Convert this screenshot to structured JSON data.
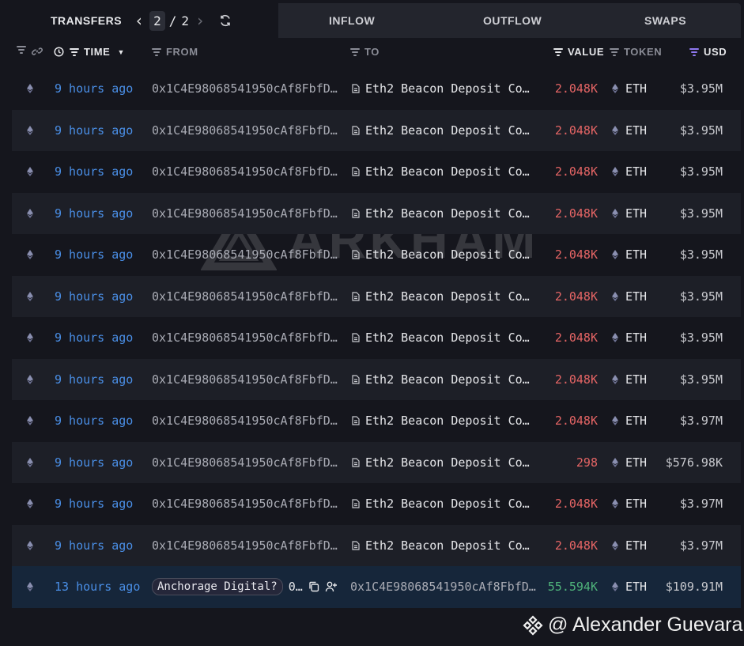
{
  "tabs": {
    "transfers": "TRANSFERS",
    "inflow": "INFLOW",
    "outflow": "OUTFLOW",
    "swaps": "SWAPS",
    "current_page": "2",
    "separator": "/",
    "total_pages": "2"
  },
  "columns": {
    "time": "TIME",
    "from": "FROM",
    "to": "TO",
    "value": "VALUE",
    "token": "TOKEN",
    "usd": "USD"
  },
  "rows": [
    {
      "time": "9 hours ago",
      "from": "0x1C4E98068541950cAf8FbfD…",
      "to": "Eth2 Beacon Deposit Co…",
      "value": "2.048K",
      "token": "ETH",
      "usd": "$3.95M"
    },
    {
      "time": "9 hours ago",
      "from": "0x1C4E98068541950cAf8FbfD…",
      "to": "Eth2 Beacon Deposit Co…",
      "value": "2.048K",
      "token": "ETH",
      "usd": "$3.95M"
    },
    {
      "time": "9 hours ago",
      "from": "0x1C4E98068541950cAf8FbfD…",
      "to": "Eth2 Beacon Deposit Co…",
      "value": "2.048K",
      "token": "ETH",
      "usd": "$3.95M"
    },
    {
      "time": "9 hours ago",
      "from": "0x1C4E98068541950cAf8FbfD…",
      "to": "Eth2 Beacon Deposit Co…",
      "value": "2.048K",
      "token": "ETH",
      "usd": "$3.95M"
    },
    {
      "time": "9 hours ago",
      "from": "0x1C4E98068541950cAf8FbfD…",
      "to": "Eth2 Beacon Deposit Co…",
      "value": "2.048K",
      "token": "ETH",
      "usd": "$3.95M"
    },
    {
      "time": "9 hours ago",
      "from": "0x1C4E98068541950cAf8FbfD…",
      "to": "Eth2 Beacon Deposit Co…",
      "value": "2.048K",
      "token": "ETH",
      "usd": "$3.95M"
    },
    {
      "time": "9 hours ago",
      "from": "0x1C4E98068541950cAf8FbfD…",
      "to": "Eth2 Beacon Deposit Co…",
      "value": "2.048K",
      "token": "ETH",
      "usd": "$3.95M"
    },
    {
      "time": "9 hours ago",
      "from": "0x1C4E98068541950cAf8FbfD…",
      "to": "Eth2 Beacon Deposit Co…",
      "value": "2.048K",
      "token": "ETH",
      "usd": "$3.95M"
    },
    {
      "time": "9 hours ago",
      "from": "0x1C4E98068541950cAf8FbfD…",
      "to": "Eth2 Beacon Deposit Co…",
      "value": "2.048K",
      "token": "ETH",
      "usd": "$3.97M"
    },
    {
      "time": "9 hours ago",
      "from": "0x1C4E98068541950cAf8FbfD…",
      "to": "Eth2 Beacon Deposit Co…",
      "value": "298",
      "token": "ETH",
      "usd": "$576.98K"
    },
    {
      "time": "9 hours ago",
      "from": "0x1C4E98068541950cAf8FbfD…",
      "to": "Eth2 Beacon Deposit Co…",
      "value": "2.048K",
      "token": "ETH",
      "usd": "$3.97M"
    },
    {
      "time": "9 hours ago",
      "from": "0x1C4E98068541950cAf8FbfD…",
      "to": "Eth2 Beacon Deposit Co…",
      "value": "2.048K",
      "token": "ETH",
      "usd": "$3.97M"
    }
  ],
  "inflow_row": {
    "time": "13 hours ago",
    "from_entity": "Anchorage Digital?",
    "from_short": "0…",
    "to": "0x1C4E98068541950cAf8FbfD…",
    "value": "55.594K",
    "token": "ETH",
    "usd": "$109.91M"
  },
  "watermark": "ARKHAM",
  "credit": "@ Alexander Guevara",
  "colors": {
    "background": "#15161d",
    "time_link": "#4a8fe7",
    "outflow_value": "#e56565",
    "inflow_value": "#4fb37a",
    "usd_filter_active": "#8f78f0"
  },
  "icons": [
    "filter-icon",
    "link-icon",
    "clock-icon",
    "sort-down-icon",
    "refresh-icon",
    "chevron-left-icon",
    "chevron-right-icon",
    "eth-icon",
    "document-icon",
    "copy-icon",
    "add-user-icon",
    "binance-icon"
  ]
}
